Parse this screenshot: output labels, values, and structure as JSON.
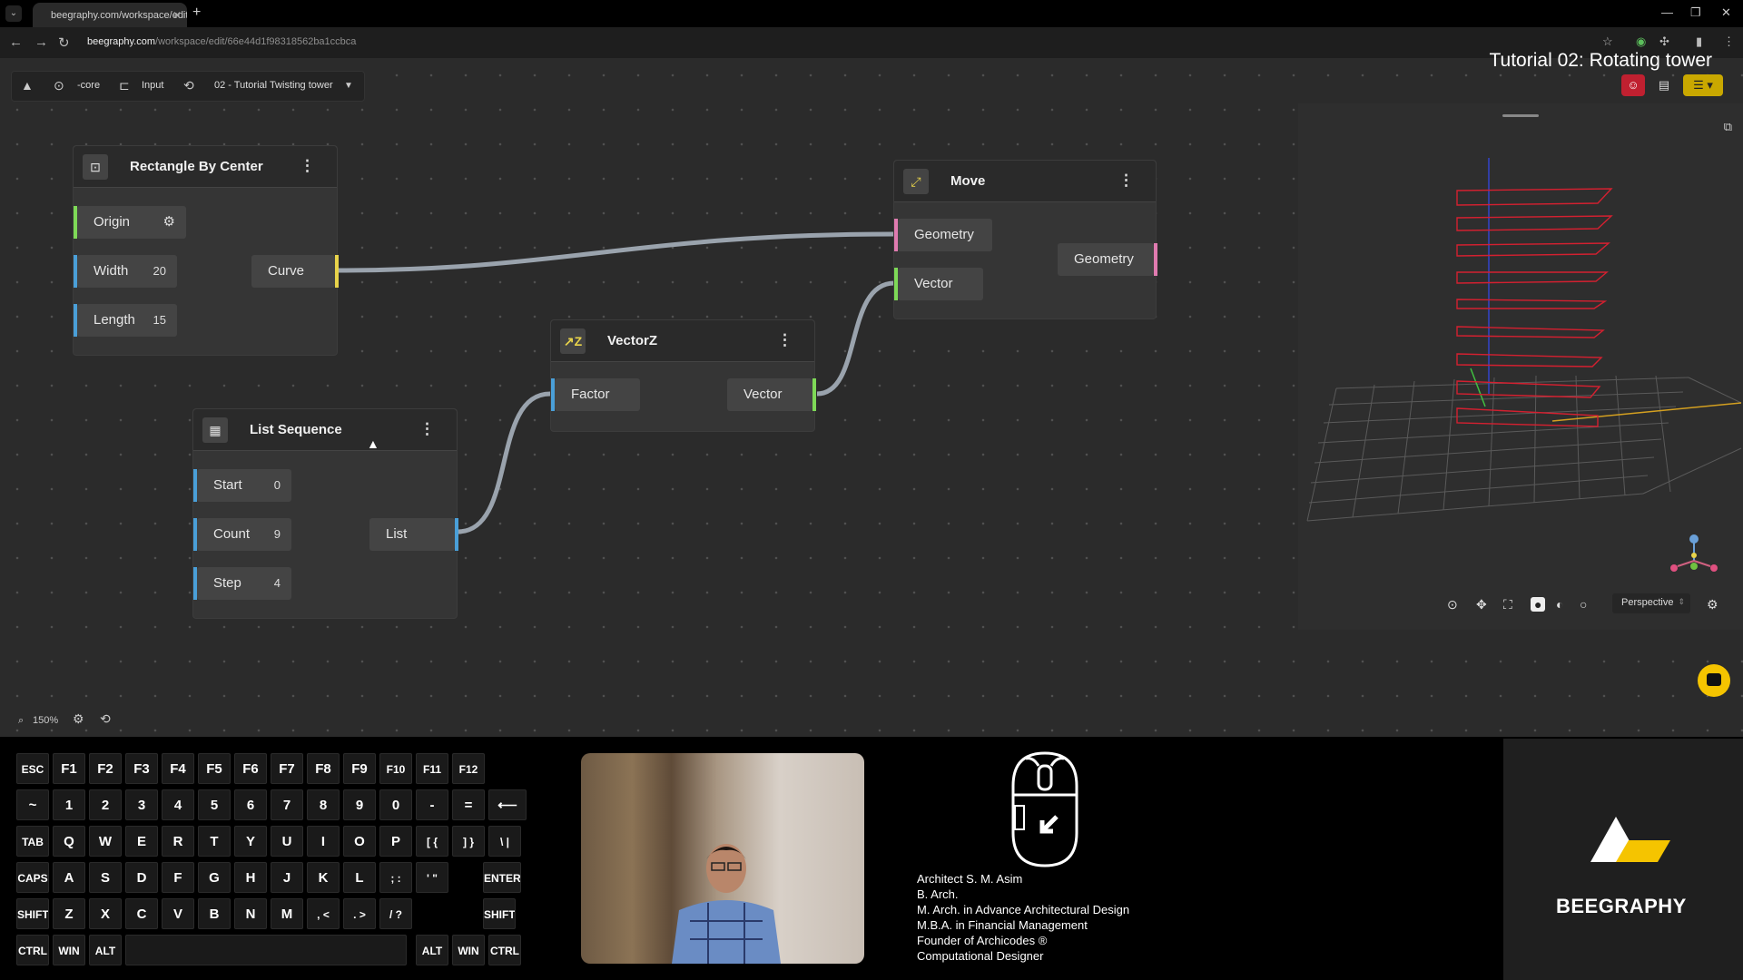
{
  "browser": {
    "tab_title": "beegraphy.com/workspace/edit",
    "url_host": "beegraphy.com",
    "url_path": "/workspace/edit/66e44d1f98318562ba1ccbca"
  },
  "overlay_title": "Tutorial 02: Rotating tower",
  "toolbar": {
    "core_label": "-core",
    "input_label": "Input",
    "project_label": "02 - Tutorial Twisting tower"
  },
  "nodes": {
    "rect": {
      "title": "Rectangle By Center",
      "inputs": [
        {
          "label": "Origin",
          "value": ""
        },
        {
          "label": "Width",
          "value": "20"
        },
        {
          "label": "Length",
          "value": "15"
        }
      ],
      "output": "Curve"
    },
    "list": {
      "title": "List Sequence",
      "inputs": [
        {
          "label": "Start",
          "value": "0"
        },
        {
          "label": "Count",
          "value": "9"
        },
        {
          "label": "Step",
          "value": "4"
        }
      ],
      "output": "List"
    },
    "vectorz": {
      "title": "VectorZ",
      "input": "Factor",
      "output": "Vector"
    },
    "move": {
      "title": "Move",
      "inputs": [
        {
          "label": "Geometry"
        },
        {
          "label": "Vector"
        }
      ],
      "output": "Geometry"
    }
  },
  "viewport": {
    "projection": "Perspective"
  },
  "status": {
    "zoom": "150%"
  },
  "keyboard": {
    "rows": [
      [
        "ESC",
        "F1",
        "F2",
        "F3",
        "F4",
        "F5",
        "F6",
        "F7",
        "F8",
        "F9",
        "F10",
        "F11",
        "F12"
      ],
      [
        "~",
        "1",
        "2",
        "3",
        "4",
        "5",
        "6",
        "7",
        "8",
        "9",
        "0",
        "-",
        "=",
        "⟵"
      ],
      [
        "TAB",
        "Q",
        "W",
        "E",
        "R",
        "T",
        "Y",
        "U",
        "I",
        "O",
        "P",
        "[ {",
        "] }",
        "\\ |"
      ],
      [
        "CAPS",
        "A",
        "S",
        "D",
        "F",
        "G",
        "H",
        "J",
        "K",
        "L",
        "; :",
        "' \"",
        "ENTER"
      ],
      [
        "SHIFT",
        "Z",
        "X",
        "C",
        "V",
        "B",
        "N",
        "M",
        ", <",
        ". >",
        "/ ?",
        "SHIFT"
      ],
      [
        "CTRL",
        "WIN",
        "ALT",
        "",
        "ALT",
        "WIN",
        "CTRL"
      ]
    ]
  },
  "credits": [
    "Architect S. M. Asim",
    "B. Arch.",
    "M. Arch. in Advance Architectural Design",
    "M.B.A. in Financial Management",
    "Founder of Archicodes ®",
    "Computational Designer"
  ],
  "brand": "BEEGRAPHY",
  "colors": {
    "canvas": "#2b2b2b",
    "port_green": "#7ed957",
    "port_blue": "#4a9fd8",
    "port_yellow": "#e8d34a",
    "port_pink": "#e07bb0",
    "accent_yellow": "#f5c400",
    "tower_red": "#d42030"
  }
}
